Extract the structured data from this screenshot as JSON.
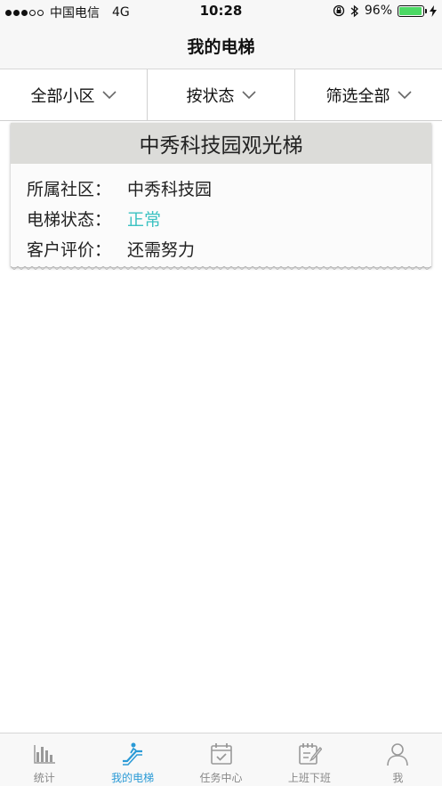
{
  "status_bar": {
    "carrier": "中国电信",
    "network": "4G",
    "time": "10:28",
    "battery": "96%",
    "battery_level": 0.96
  },
  "nav": {
    "title": "我的电梯"
  },
  "filters": [
    {
      "label": "全部小区",
      "icon": "chevron-down-icon"
    },
    {
      "label": "按状态",
      "icon": "chevron-down-icon"
    },
    {
      "label": "筛选全部",
      "icon": "chevron-down-icon"
    }
  ],
  "elevator_card": {
    "title": "中秀科技园观光梯",
    "rows": [
      {
        "label": "所属社区：",
        "value": "中秀科技园"
      },
      {
        "label": "电梯状态：",
        "value": "正常"
      },
      {
        "label": "客户评价：",
        "value": "还需努力"
      }
    ]
  },
  "tabs": [
    {
      "label": "统计",
      "icon": "bar-chart-icon"
    },
    {
      "label": "我的电梯",
      "icon": "escalator-icon",
      "active": true
    },
    {
      "label": "任务中心",
      "icon": "calendar-check-icon"
    },
    {
      "label": "上班下班",
      "icon": "clipboard-pen-icon"
    },
    {
      "label": "我",
      "icon": "user-icon"
    }
  ],
  "colors": {
    "accent": "#2a9ad6",
    "status_ok": "#3cc2c2",
    "tab_inactive": "#888888",
    "battery": "#4cd964"
  }
}
